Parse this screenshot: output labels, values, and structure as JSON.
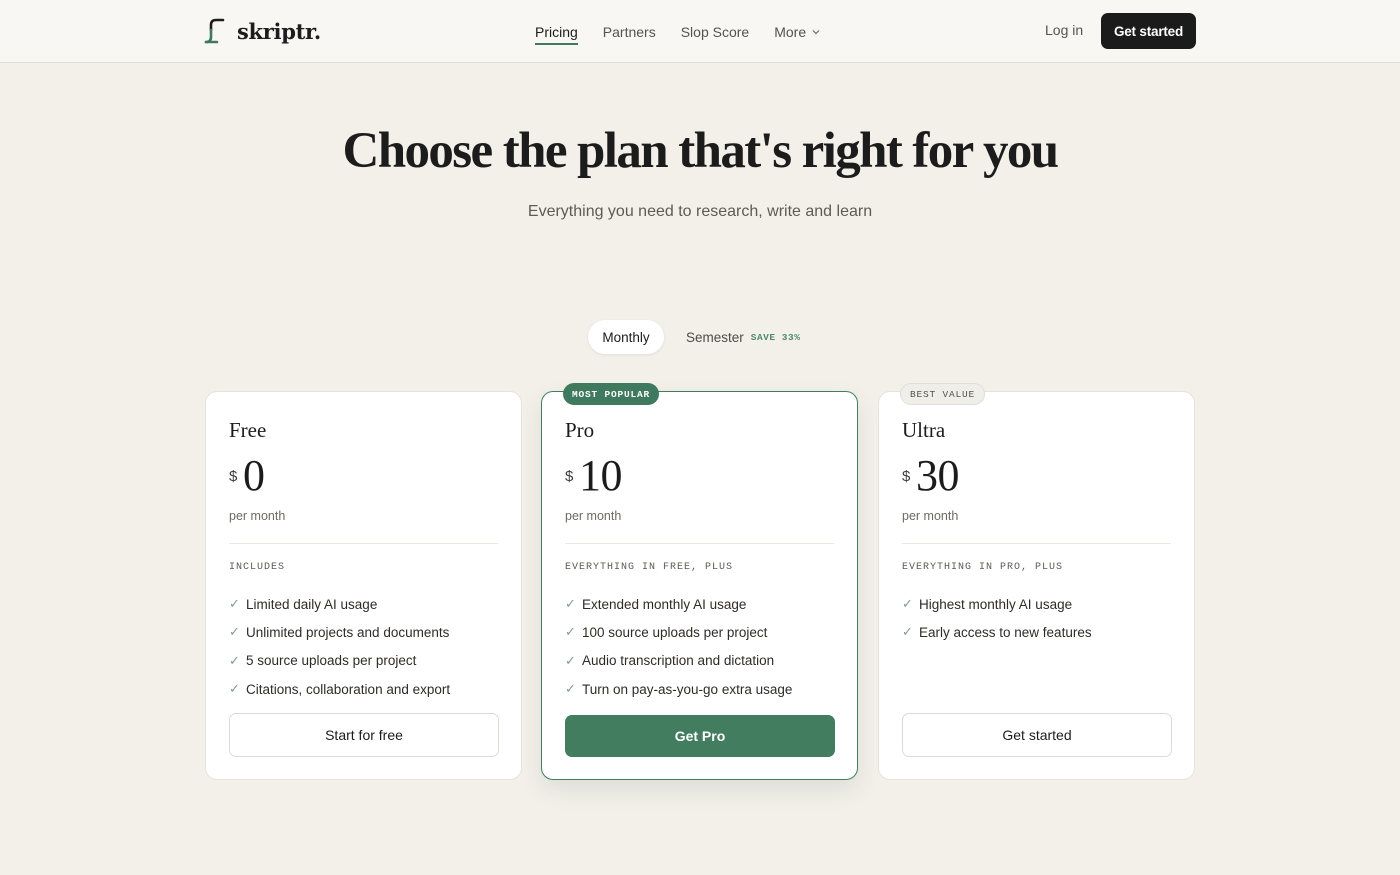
{
  "brand": {
    "name": "skriptr."
  },
  "nav": {
    "items": [
      {
        "label": "Pricing",
        "active": true
      },
      {
        "label": "Partners",
        "active": false
      },
      {
        "label": "Slop Score",
        "active": false
      },
      {
        "label": "More",
        "active": false
      }
    ],
    "login": "Log in",
    "cta": "Get started"
  },
  "hero": {
    "title": "Choose the plan that's right for you",
    "subtitle": "Everything you need to research, write and learn"
  },
  "billing": {
    "monthly": "Monthly",
    "semester": "Semester",
    "save_badge": "SAVE 33%",
    "selected": "Monthly"
  },
  "plans": [
    {
      "name": "Free",
      "currency": "$",
      "price": "0",
      "period": "per month",
      "features_heading": "INCLUDES",
      "features": [
        "Limited daily AI usage",
        "Unlimited projects and documents",
        "5 source uploads per project",
        "Citations, collaboration and export"
      ],
      "button": "Start for free"
    },
    {
      "name": "Pro",
      "badge": "MOST POPULAR",
      "currency": "$",
      "price": "10",
      "period": "per month",
      "features_heading": "EVERYTHING IN FREE, PLUS",
      "features": [
        "Extended monthly AI usage",
        "100 source uploads per project",
        "Audio transcription and dictation",
        "Turn on pay-as-you-go extra usage"
      ],
      "button": "Get Pro"
    },
    {
      "name": "Ultra",
      "badge": "BEST VALUE",
      "currency": "$",
      "price": "30",
      "period": "per month",
      "features_heading": "EVERYTHING IN PRO, PLUS",
      "features": [
        "Highest monthly AI usage",
        "Early access to new features"
      ],
      "button": "Get started"
    }
  ],
  "icons": {
    "check": "check-icon",
    "chevron": "chevron-down-icon",
    "logo": "skriptr-logo-icon"
  },
  "colors": {
    "accent": "#3f7a5f",
    "background": "#f3f0ea",
    "dark_button": "#1b1b1b"
  }
}
